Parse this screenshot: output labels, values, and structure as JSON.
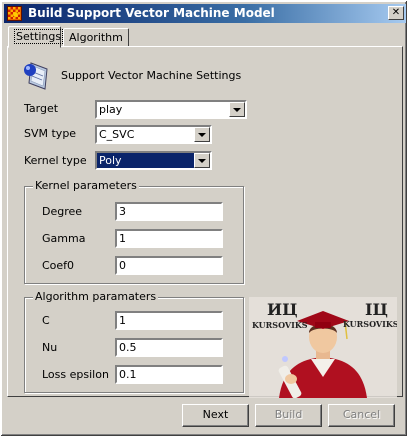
{
  "window": {
    "title": "Build Support Vector Machine Model",
    "close_glyph": "✕"
  },
  "tabs": [
    {
      "label": "Settings",
      "active": true
    },
    {
      "label": "Algorithm",
      "active": false
    }
  ],
  "header": {
    "text": "Support Vector Machine Settings",
    "icon": "svm-model-icon"
  },
  "fields": {
    "target": {
      "label": "Target",
      "value": "play"
    },
    "svm_type": {
      "label": "SVM type",
      "value": "C_SVC"
    },
    "kernel_type": {
      "label": "Kernel type",
      "value": "Poly"
    }
  },
  "kernel_parameters": {
    "title": "Kernel parameters",
    "degree": {
      "label": "Degree",
      "value": "3"
    },
    "gamma": {
      "label": "Gamma",
      "value": "1"
    },
    "coef0": {
      "label": "Coef0",
      "value": "0"
    }
  },
  "algorithm_parameters": {
    "title": "Algorithm paramaters",
    "c": {
      "label": "C",
      "value": "1"
    },
    "nu": {
      "label": "Nu",
      "value": "0.5"
    },
    "loss_epsilon": {
      "label": "Loss epsilon",
      "value": "0.1"
    }
  },
  "buttons": {
    "next": "Next",
    "build": "Build",
    "cancel": "Cancel"
  },
  "watermark": {
    "left_text": "ИЦ",
    "right_text": "ІЦ",
    "brand": "KURSOVIKS"
  },
  "colors": {
    "title_bar": "#0a246a",
    "selection": "#0a246a",
    "gown": "#b01020"
  }
}
